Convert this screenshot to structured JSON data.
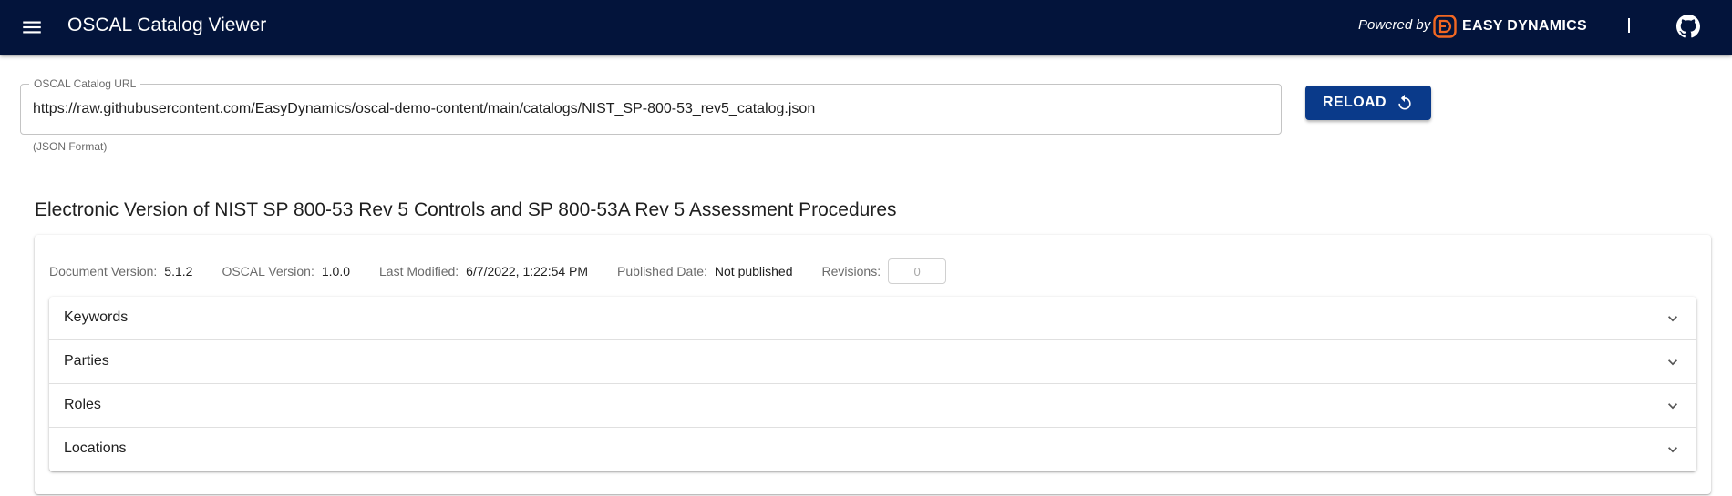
{
  "appbar": {
    "title": "OSCAL Catalog Viewer",
    "powered_by": "Powered by",
    "brand_name": "EASY DYNAMICS",
    "divider": "|",
    "menu_icon": "menu-icon",
    "github_icon": "github-icon"
  },
  "url_field": {
    "label": "OSCAL Catalog URL",
    "value": "https://raw.githubusercontent.com/EasyDynamics/oscal-demo-content/main/catalogs/NIST_SP-800-53_rev5_catalog.json",
    "helper": "(JSON Format)"
  },
  "reload_button": {
    "label": "RELOAD",
    "icon": "refresh-icon"
  },
  "catalog": {
    "title": "Electronic Version of NIST SP 800-53 Rev 5 Controls and SP 800-53A Rev 5 Assessment Procedures",
    "metadata": {
      "document_version_label": "Document Version:",
      "document_version": "5.1.2",
      "oscal_version_label": "OSCAL Version:",
      "oscal_version": "1.0.0",
      "last_modified_label": "Last Modified:",
      "last_modified": "6/7/2022, 1:22:54 PM",
      "published_date_label": "Published Date:",
      "published_date": "Not published",
      "revisions_label": "Revisions:",
      "revisions": "0"
    },
    "sections": [
      "Keywords",
      "Parties",
      "Roles",
      "Locations"
    ]
  },
  "colors": {
    "appbar_bg": "#03143b",
    "brand_accent": "#f26722",
    "button_bg": "#0a3a8a"
  }
}
